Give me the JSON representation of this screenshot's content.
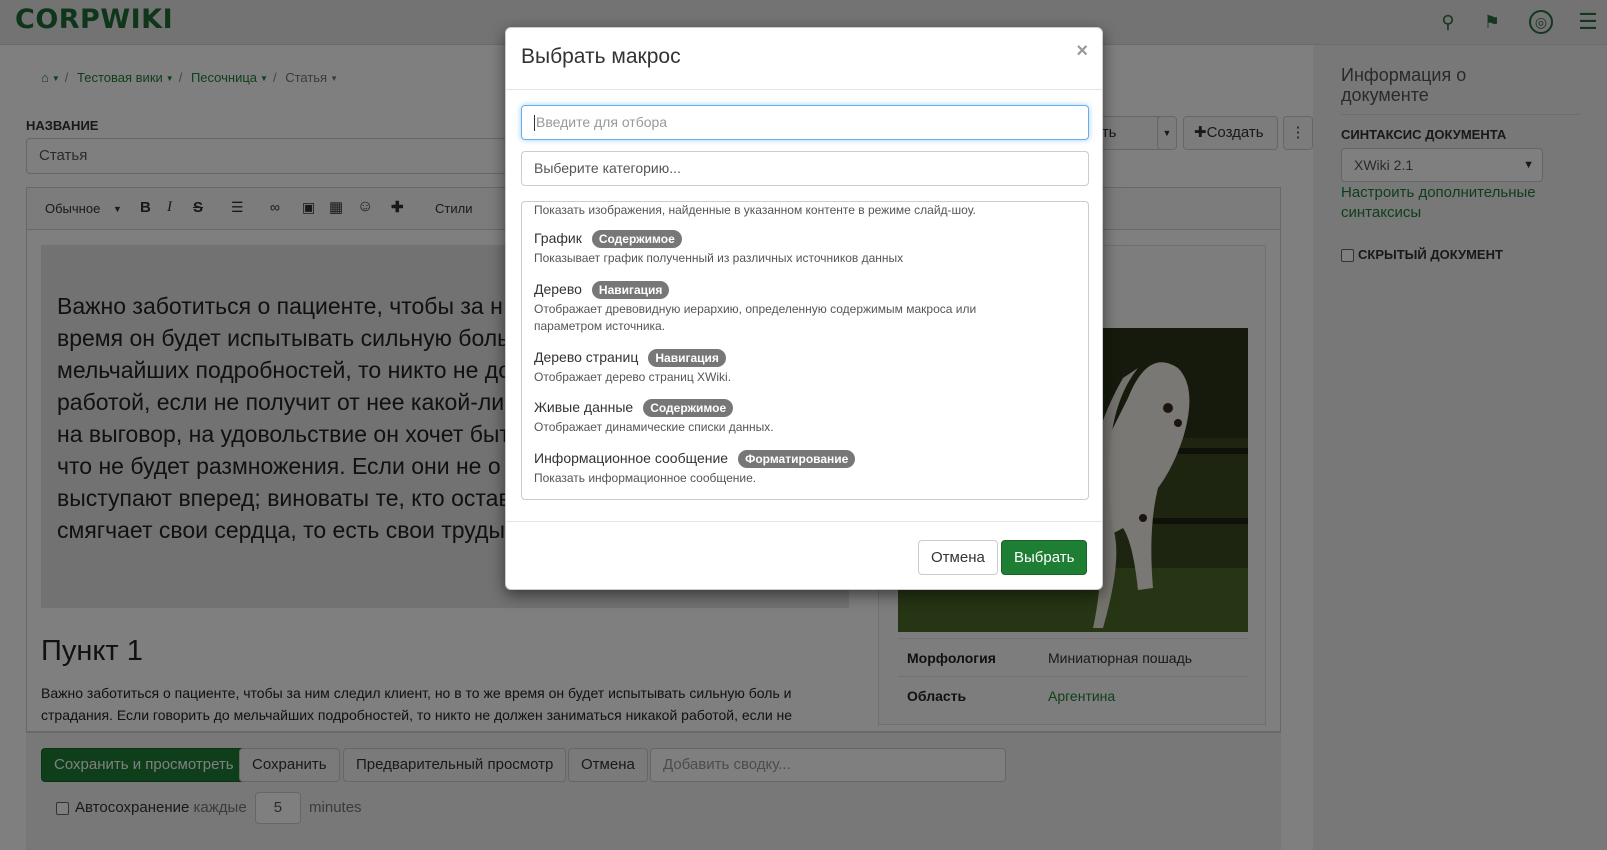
{
  "header": {
    "logo": "CORPWIKI",
    "icons": [
      "search-icon",
      "bell-icon",
      "globe-icon",
      "menu-icon"
    ]
  },
  "breadcrumb": {
    "items": [
      "Тестовая вики",
      "Песочница",
      "Статья"
    ]
  },
  "title": {
    "label": "НАЗВАНИЕ",
    "value": "Статья"
  },
  "edit_actions": {
    "edit_partial": "вать",
    "create": "Создать"
  },
  "toolbar": {
    "format": "Обычное",
    "styles": "Стили"
  },
  "content": {
    "quote_lines": [
      "Важно заботиться о пациенте, чтобы за н",
      "время он будет испытывать сильную боль",
      "мельчайших подробностей, то никто не до",
      "работой, если не получит от нее какой-ли",
      "на выговор, на удовольствие он хочет быт",
      "что не будет размножения.  Если они не о",
      "выступают вперед; виноваты те, кто остав",
      "смягчает свои сердца, то есть свои труды"
    ],
    "heading": "Пункт 1",
    "paragraph_lines": [
      "Важно заботиться о пациенте, чтобы за ним следил клиент, но в то же время он будет испытывать сильную боль и",
      "страдания.  Если говорить до мельчайших подробностей, то никто не должен заниматься никакой работой, если не"
    ]
  },
  "infobox": {
    "rows": [
      {
        "key": "Морфология",
        "value": "Миниатюрная пошадь"
      },
      {
        "key": "Область",
        "value": "Аргентина"
      }
    ]
  },
  "bottom_bar": {
    "save_view": "Сохранить и просмотреть",
    "save": "Сохранить",
    "preview": "Предварительный просмотр",
    "cancel": "Отмена",
    "summary_placeholder": "Добавить сводку...",
    "autosave_label": "Автосохранение",
    "autosave_every": "каждые",
    "autosave_value": "5",
    "autosave_unit": "minutes"
  },
  "sidebar": {
    "title": "Информация о документе",
    "syntax_label": "СИНТАКСИС ДОКУМЕНТА",
    "syntax_value": "XWiki 2.1",
    "syntax_link": "Настроить дополнительные синтаксисы",
    "hidden_label": "СКРЫТЫЙ ДОКУМЕНТ"
  },
  "modal": {
    "title": "Выбрать макрос",
    "filter_placeholder": "Введите для отбора",
    "category_placeholder": "Выберите категорию...",
    "partial_desc": "Показать изображения, найденные в указанном контенте в режиме слайд-шоу.",
    "macros": [
      {
        "name": "График",
        "badge": "Содержимое",
        "desc": "Показывает график полученный из различных источников данных"
      },
      {
        "name": "Дерево",
        "badge": "Навигация",
        "desc": "Отображает древовидную иерархию, определенную содержимым макроса или",
        "desc2": "параметром источника."
      },
      {
        "name": "Дерево страниц",
        "badge": "Навигация",
        "desc": "Отображает дерево страниц XWiki."
      },
      {
        "name": "Живые данные",
        "badge": "Содержимое",
        "desc": "Отображает динамические списки данных."
      },
      {
        "name": "Информационное сообщение",
        "badge": "Форматирование",
        "desc": "Показать информационное сообщение."
      }
    ],
    "cancel": "Отмена",
    "select": "Выбрать"
  }
}
